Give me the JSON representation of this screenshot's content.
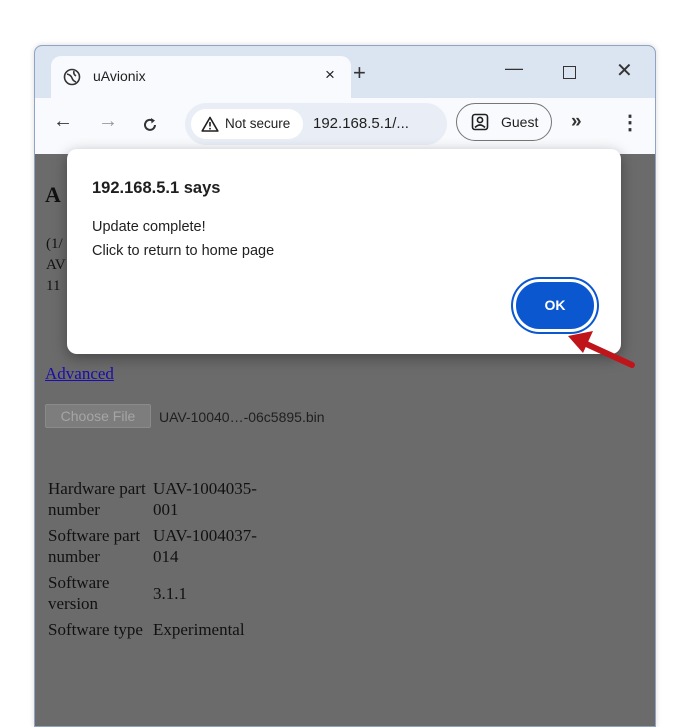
{
  "browser": {
    "tab_title": "uAvionix",
    "tab_close": "×",
    "new_tab": "+",
    "window_minimize": "—",
    "window_close": "✕",
    "security_label": "Not secure",
    "url": "192.168.5.1/...",
    "profile_label": "Guest",
    "extensions_more": "»",
    "menu": "⋮",
    "icons": [
      "globe-icon",
      "back-arrow-icon",
      "forward-arrow-icon",
      "reload-icon",
      "warning-icon",
      "profile-icon",
      "menu-dots-icon"
    ]
  },
  "page": {
    "heading_fragment": "A",
    "para_fragments": [
      "(1/",
      "AV",
      "11"
    ],
    "advanced_link": "Advanced",
    "choose_file_label": "Choose File",
    "selected_file": "UAV-10040…-06c5895.bin",
    "info_rows": [
      {
        "label": "Hardware part number",
        "value": "UAV-1004035-001"
      },
      {
        "label": "Software part number",
        "value": "UAV-1004037-014"
      },
      {
        "label": "Software version",
        "value": "3.1.1"
      },
      {
        "label": "Software type",
        "value": "Experimental"
      }
    ]
  },
  "dialog": {
    "title": "192.168.5.1 says",
    "message_line1": "Update complete!",
    "message_line2": "Click to return to home page",
    "ok_label": "OK"
  },
  "colors": {
    "accent": "#0b57d0",
    "annotation_arrow": "#c0141b",
    "page_overlay": "#6b6b6b",
    "tabstrip": "#dbe4f1"
  }
}
